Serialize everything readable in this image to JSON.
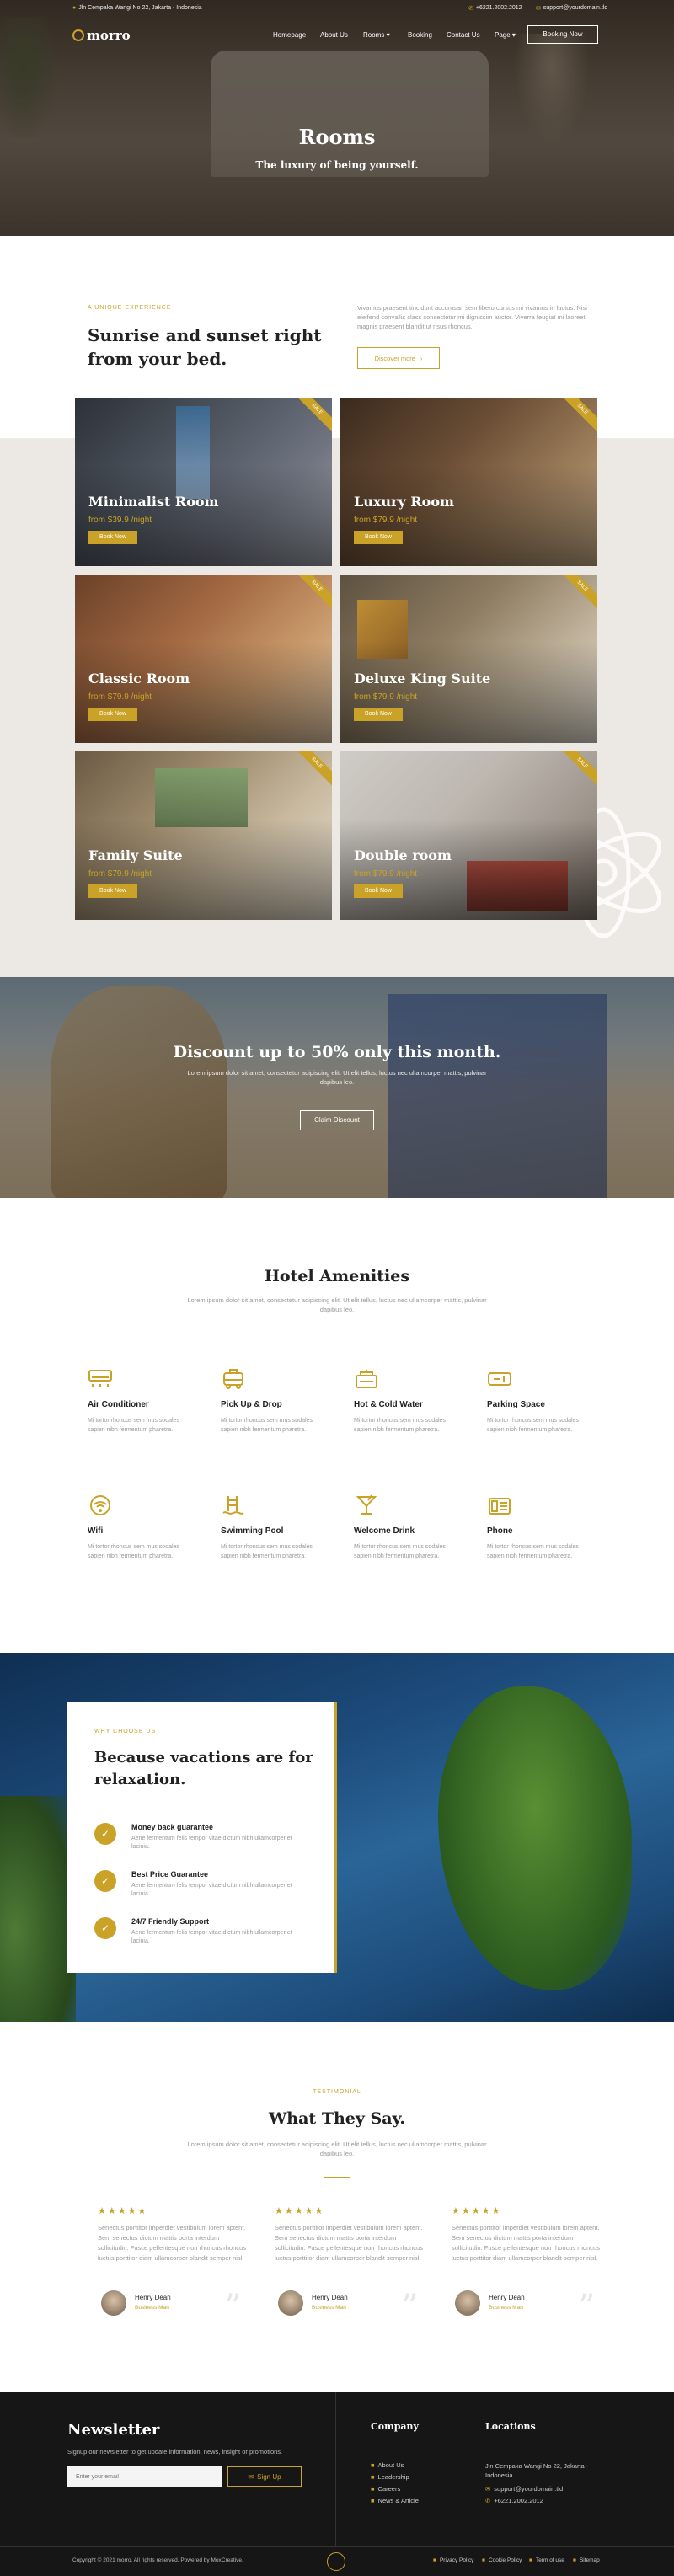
{
  "topbar": {
    "address": "Jln Cempaka Wangi No 22, Jakarta - Indonesia",
    "phone": "+6221.2002.2012",
    "email": "support@yourdomain.tld"
  },
  "nav": {
    "logo": "morro",
    "items": [
      "Homepage",
      "About Us",
      "Rooms",
      "Booking",
      "Contact Us",
      "Page"
    ],
    "cta": "Booking Now"
  },
  "hero": {
    "title": "Rooms",
    "subtitle": "The luxury of being yourself."
  },
  "intro": {
    "eyebrow": "A UNIQUE EXPERIENCE",
    "title": "Sunrise and sunset right from your bed.",
    "body": "Vivamus praesent tincidunt accumsan sem libero cursus mi vivamus in luctus. Nisi eleifend convallis class consectetur mi dignissim auctor. Viverra feugiat mi laoreet magnis praesent blandit ut risus rhoncus.",
    "button": "Discover more"
  },
  "rooms": [
    {
      "name": "Minimalist Room",
      "price": "from $39.9 /night",
      "button": "Book Now",
      "badge": "SALE"
    },
    {
      "name": "Luxury Room",
      "price": "from $79.9 /night",
      "button": "Book Now",
      "badge": "SALE"
    },
    {
      "name": "Classic Room",
      "price": "from $79.9 /night",
      "button": "Book Now",
      "badge": "SALE"
    },
    {
      "name": "Deluxe King Suite",
      "price": "from $79.9 /night",
      "button": "Book Now",
      "badge": "SALE"
    },
    {
      "name": "Family Suite",
      "price": "from $79.9 /night",
      "button": "Book Now",
      "badge": "SALE"
    },
    {
      "name": "Double room",
      "price": "from $79.9 /night",
      "button": "Book Now",
      "badge": "SALE"
    }
  ],
  "discount": {
    "title": "Discount up to 50% only this month.",
    "body": "Lorem ipsum dolor sit amet, consectetur adipiscing elit. Ut elit tellus, luctus nec ullamcorper mattis, pulvinar dapibus leo.",
    "button": "Claim Discount"
  },
  "amenities": {
    "title": "Hotel Amenities",
    "subtitle": "Lorem ipsum dolor sit amet, consectetur adipiscing elit. Ut elit tellus, luctus nec ullamcorper mattis, pulvinar dapibus leo.",
    "items": [
      {
        "icon": "air-conditioner-icon",
        "title": "Air Conditioner",
        "desc": "Mi tortor rhoncus sem mus sodales sapien nibh fermentum pharetra."
      },
      {
        "icon": "pickup-drop-icon",
        "title": "Pick Up & Drop",
        "desc": "Mi tortor rhoncus sem mus sodales sapien nibh fermentum pharetra."
      },
      {
        "icon": "hot-cold-water-icon",
        "title": "Hot & Cold Water",
        "desc": "Mi tortor rhoncus sem mus sodales sapien nibh fermentum pharetra."
      },
      {
        "icon": "parking-icon",
        "title": "Parking Space",
        "desc": "Mi tortor rhoncus sem mus sodales sapien nibh fermentum pharetra."
      },
      {
        "icon": "wifi-icon",
        "title": "Wifi",
        "desc": "Mi tortor rhoncus sem mus sodales sapien nibh fermentum pharetra."
      },
      {
        "icon": "swimming-pool-icon",
        "title": "Swimming Pool",
        "desc": "Mi tortor rhoncus sem mus sodales sapien nibh fermentum pharetra."
      },
      {
        "icon": "welcome-drink-icon",
        "title": "Welcome Drink",
        "desc": "Mi tortor rhoncus sem mus sodales sapien nibh fermentum pharetra."
      },
      {
        "icon": "phone-icon",
        "title": "Phone",
        "desc": "Mi tortor rhoncus sem mus sodales sapien nibh fermentum pharetra."
      }
    ]
  },
  "why": {
    "eyebrow": "WHY CHOOSE US",
    "title": "Because vacations are for relaxation.",
    "items": [
      {
        "title": "Money back guarantee",
        "desc": "Aene fermentum felis tempor vitae dictum nibh ullamcorper et lacinia."
      },
      {
        "title": "Best Price Guarantee",
        "desc": "Aene fermentum felis tempor vitae dictum nibh ullamcorper et lacinia."
      },
      {
        "title": "24/7 Friendly Support",
        "desc": "Aene fermentum felis tempor vitae dictum nibh ullamcorper et lacinia."
      }
    ]
  },
  "testimonial": {
    "eyebrow": "TESTIMONIAL",
    "title": "What They Say.",
    "subtitle": "Lorem ipsum dolor sit amet, consectetur adipiscing elit. Ut elit tellus, luctus nec ullamcorper mattis, pulvinar dapibus leo.",
    "stars": "★★★★★",
    "items": [
      {
        "text": "Senectus porttitor imperdiet vestibulum lorem aptent. Sem senectus dictum mattis porta interdum sollicitudin. Fusce pellentesque non rhoncus rhoncus luctus porttitor diam ullamcorper blandit semper nisl.",
        "name": "Henry Dean",
        "role": "Business Man"
      },
      {
        "text": "Senectus porttitor imperdiet vestibulum lorem aptent. Sem senectus dictum mattis porta interdum sollicitudin. Fusce pellentesque non rhoncus rhoncus luctus porttitor diam ullamcorper blandit semper nisl.",
        "name": "Henry Dean",
        "role": "Business Man"
      },
      {
        "text": "Senectus porttitor imperdiet vestibulum lorem aptent. Sem senectus dictum mattis porta interdum sollicitudin. Fusce pellentesque non rhoncus rhoncus luctus porttitor diam ullamcorper blandit semper nisl.",
        "name": "Henry Dean",
        "role": "Business Man"
      }
    ]
  },
  "footer": {
    "newsletter_title": "Newsletter",
    "newsletter_text": "Signup our newsletter to get update information, news, insight or promotions.",
    "email_placeholder": "Enter your email",
    "signup": "Sign Up",
    "company_title": "Company",
    "company_links": [
      "About Us",
      "Leadership",
      "Careers",
      "News & Article"
    ],
    "locations_title": "Locations",
    "location_address": "Jln Cempaka Wangi No 22, Jakarta - Indonesia",
    "location_email": "support@yourdomain.tld",
    "location_phone": "+6221.2002.2012",
    "copyright": "Copyright © 2021 morro. All rights reserved. Powered by MoxCreative.",
    "legal_links": [
      "Privacy Policy",
      "Cookie Policy",
      "Term of use",
      "Sitemap"
    ]
  },
  "colors": {
    "accent": "#c9a227",
    "dark": "#161616",
    "beige": "#ece9e4"
  }
}
